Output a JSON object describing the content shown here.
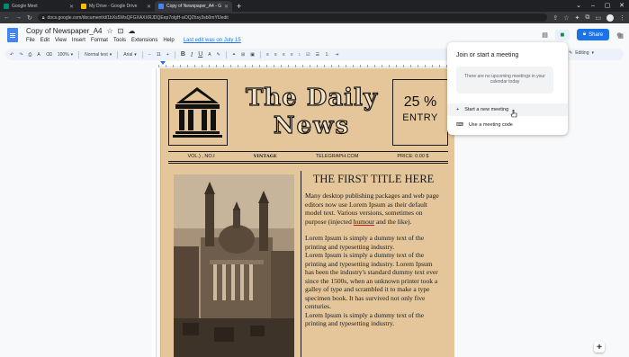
{
  "browser": {
    "tabs": [
      {
        "label": "Google Meet",
        "color": "#00897b"
      },
      {
        "label": "My Drive - Google Drive",
        "color": "#fbbc04"
      },
      {
        "label": "Copy of Newspaper_A4 - Googl...",
        "color": "#4285f4"
      }
    ],
    "new_tab": "+",
    "url": "docs.google.com/document/d/1bXs5WsQFGXAXXRJDQEep7olgH-aOQZhsy3sb0mYfJedit"
  },
  "docs": {
    "title": "Copy of Newspaper_A4",
    "menus": [
      "File",
      "Edit",
      "View",
      "Insert",
      "Format",
      "Tools",
      "Extensions",
      "Help"
    ],
    "last_edit": "Last edit was on July 15",
    "share_label": "Share",
    "toolbar": {
      "zoom": "100%",
      "style": "Normal text",
      "font": "Arial",
      "size": "11",
      "bold": "B",
      "italic": "I",
      "underline": "U",
      "text_color": "A",
      "mode": "Editing"
    }
  },
  "newspaper": {
    "title_line1": "The Daily",
    "title_line2": "News",
    "price_pct": "25 %",
    "price_entry": "ENTRY",
    "vol": "VOL.) , NO.I",
    "vintage": "VINTAGE",
    "site": "TELEGRAPH.COM",
    "price": "PRICE: 0.00 $",
    "article_title": "THE FIRST TITLE HERE",
    "para1_a": "Many desktop publishing packages and web page editors now use Lorem Ipsum as their default model text. Various versions, sometimes on purpose (injected ",
    "para1_ul": "humour",
    "para1_b": " and the like).",
    "para2": "Lorem Ipsum is simply a dummy text of the printing and typesetting industry.",
    "para3": "Lorem Ipsum is simply a dummy text of the printing and typesetting industry. Lorem Ipsum has been the industry's standard dummy text ever since the 1500s, when an unknown printer took a galley of type and scrambled it to make a type specimen book. It has survived not only five centuries.",
    "para4": "Lorem Ipsum is simply a dummy text of the printing and typesetting industry."
  },
  "meet_popup": {
    "title": "Join or start a meeting",
    "empty": "There are no upcoming meetings in your calendar today",
    "start": "Start a new meeting",
    "code": "Use a meeting code"
  }
}
